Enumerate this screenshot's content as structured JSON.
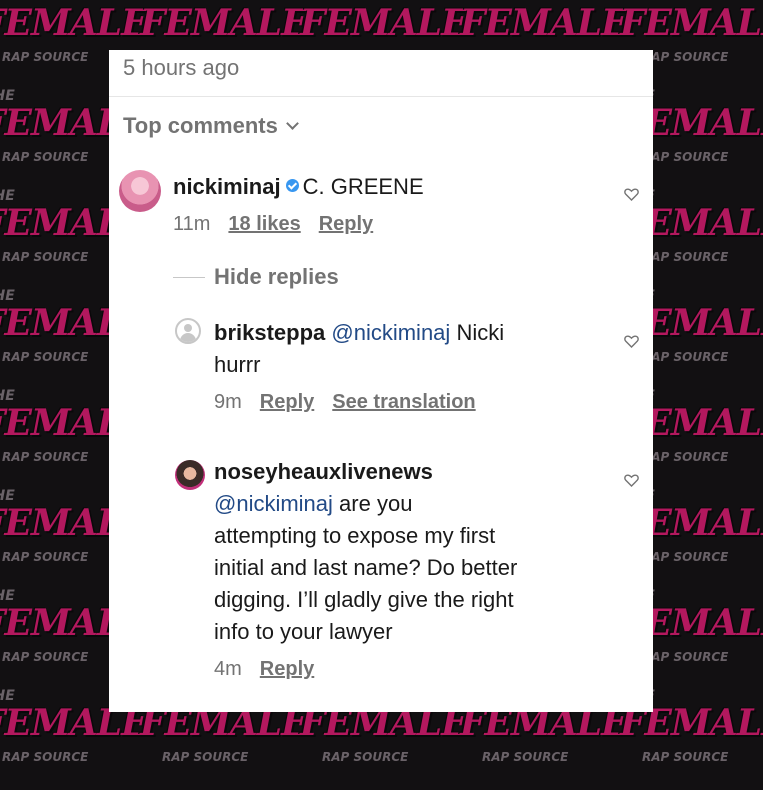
{
  "watermark": {
    "top": "THE",
    "main": "FEMALE",
    "bottom": "RAP SOURCE"
  },
  "post": {
    "timestamp": "5 hours ago"
  },
  "comments_header": {
    "label": "Top comments"
  },
  "comment": {
    "username": "nickiminaj",
    "text": "C. GREENE",
    "time": "11m",
    "likes": "18 likes",
    "reply_label": "Reply"
  },
  "hide_replies_label": "Hide replies",
  "replies": [
    {
      "username": "briksteppa",
      "mention": "@nickiminaj",
      "text_line1": "Nicki",
      "text_line2": "hurrr",
      "time": "9m",
      "reply_label": "Reply",
      "translate_label": "See translation"
    },
    {
      "username": "noseyheauxlivenews",
      "mention": "@nickiminaj",
      "line1": "are you",
      "line2": "attempting to expose my first",
      "line3": "initial and last name? Do better",
      "line4": "digging. I’ll gladly give the right",
      "line5": "info to your lawyer",
      "time": "4m",
      "reply_label": "Reply"
    }
  ]
}
